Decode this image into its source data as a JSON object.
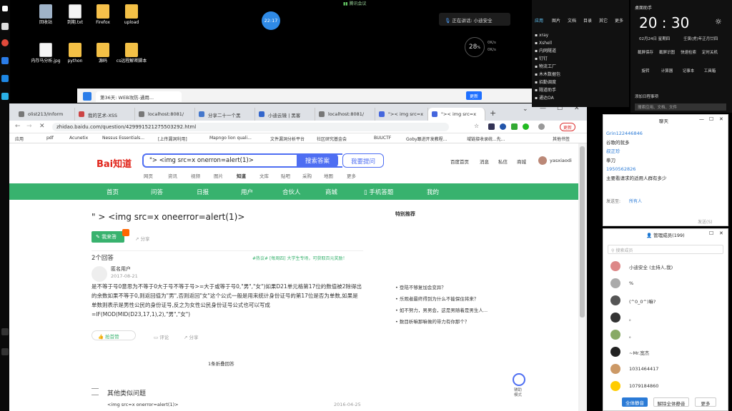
{
  "desktop": {
    "icons": [
      {
        "label": "回收站",
        "icon": "recycle-bin-icon"
      },
      {
        "label": "到期.txt",
        "icon": "text-file-icon"
      },
      {
        "label": "Firefox",
        "icon": "firefox-icon"
      },
      {
        "label": "upload",
        "icon": "folder-icon"
      },
      {
        "label": "内存马分析.jpg",
        "icon": "image-file-icon"
      },
      {
        "label": "python",
        "icon": "folder-icon"
      },
      {
        "label": "源码",
        "icon": "folder-icon"
      },
      {
        "label": "cs远程解密脚本",
        "icon": "folder-icon"
      }
    ],
    "clock_badge": "22:17",
    "meeting_top": "腾讯会议",
    "speaking": "正在讲话: 小迪安全",
    "speed_value": "28",
    "speed_unit": "%",
    "speed_up": "0K/s",
    "speed_down": "0K/s"
  },
  "back_window": {
    "title": "第36天: WEB攻防-通用..."
  },
  "chrome": {
    "tabs": [
      {
        "label": "olist213/Inform"
      },
      {
        "label": "我的艺术-XSS"
      },
      {
        "label": "localhost:8081/"
      },
      {
        "label": "分享二十一个黑"
      },
      {
        "label": "小迪云镜 | 黑客"
      },
      {
        "label": "localhost:8081/"
      },
      {
        "label": "\">< img src=x"
      },
      {
        "label": "\">< img src=x"
      }
    ],
    "url": "zhidao.baidu.com/question/429991521275503292.html",
    "update_label": "更新",
    "bookmarks": [
      "应用",
      "pdf",
      "Acunetix",
      "Nessus Essentials...",
      "[上传漏洞利用]",
      "Mapngo lion quali...",
      "文件漏洞分析平台",
      "社区研究基金会",
      "BUUCTF",
      "Goby跟进开发教程...",
      "域链接收录统...先..."
    ],
    "other_bookmarks": "其他书签"
  },
  "baidu": {
    "logo": "Bai知道",
    "search_value": "\"> <img src=x onerron=alert(1)>",
    "search_btn": "搜索答案",
    "ask_btn": "我要提问",
    "top_links": [
      "百度首页",
      "消息",
      "私信",
      "商城"
    ],
    "username": "yasxiaodi",
    "subnav": [
      "网页",
      "资讯",
      "视频",
      "图片",
      "知道",
      "文库",
      "贴吧",
      "采购",
      "地图",
      "更多"
    ],
    "nav": [
      "首页",
      "问答",
      "日报",
      "用户",
      "合伙人",
      "商城",
      "手机答题",
      "我的"
    ],
    "question_title": "\" > <img src=x oneerror=alert(1)>",
    "answer_btn": "我来答",
    "share": "分享",
    "answer_count": "2个回答",
    "tag": "#热议# [每周四] 大学生专场，可获取百元奖励！",
    "user": "匿名用户",
    "date": "2017-08-21",
    "answer_text": "是不等于号0意思为不等于0大于号不等于号>=大于或等于号0,\"男\",\"女\")如果D21单元格第17位的数值被2除得出的余数如果不等于0,则返回值为\"男\",否则返回\"女\"这个公式一般是用来统计身份证号的第17位是否为单数,如果是单数则表示是男性公民的身份证号,反之为女性公民身份证号公式也可以写成=IF(MOD(MID(D23,17,1),2),\"男\",\"女\")",
    "like": "抢首赞",
    "comment": "评论",
    "share2": "分享",
    "collapsed": "1条折叠回答",
    "similar": "其他类似问题",
    "similar_item": "<img src=x onerror=alert(1)>",
    "similar_date": "2016-04-25",
    "recommend": "特别推荐",
    "recommend_items": [
      "登陆不够复加会变异？",
      "乐观者最终得到为什么不能保住将来？",
      "如不努力，男男会，这是男随着是男生人...",
      "数目析嘛那嘛做的带力有你那个？"
    ],
    "side_float": "辅助模式"
  },
  "chat": {
    "title": "聊天",
    "messages": [
      {
        "name": "Grin122446846",
        "text": "谷歌的就多"
      },
      {
        "name": "叔正珍",
        "text": "拳刀"
      },
      {
        "name": "1950562826",
        "text": "主要看请求的适用人群有多少"
      }
    ],
    "send_to_label": "发送至:",
    "send_to": "所有人",
    "send": "发送(S)"
  },
  "members": {
    "title": "管理成员(199)",
    "search_placeholder": "搜索成员",
    "list": [
      "小迪安全 (主持人,我)",
      "%",
      "(^0_0^)嘛?",
      "。",
      "。",
      "~Mr.宽杰",
      "1031464417",
      "1079184860"
    ],
    "mute_all": "全体静音",
    "unmute_all": "解除全体静音",
    "more": "更多"
  },
  "right_top": {
    "tabs": [
      "应用",
      "图片",
      "文档",
      "目录",
      "其它",
      "更多"
    ],
    "apps": [
      "xray",
      "Xshell",
      "内网隧道",
      "钉钉",
      "物流工厂",
      "木木数据包",
      "招勤调度",
      "隧道助手",
      "通达OA"
    ],
    "clock": "20 : 30",
    "date": "02月24日 星期四",
    "lunar": "壬寅(虎)年正月廿四",
    "assistant": "桌面助手",
    "tools": [
      "截屏保存",
      "截屏识图",
      "快速检索",
      "定时关机",
      "旋转",
      "计算器",
      "记事本",
      "工具箱"
    ],
    "add_note": "添加日程事项",
    "search_tip": "搜索应用、文档、文件"
  }
}
